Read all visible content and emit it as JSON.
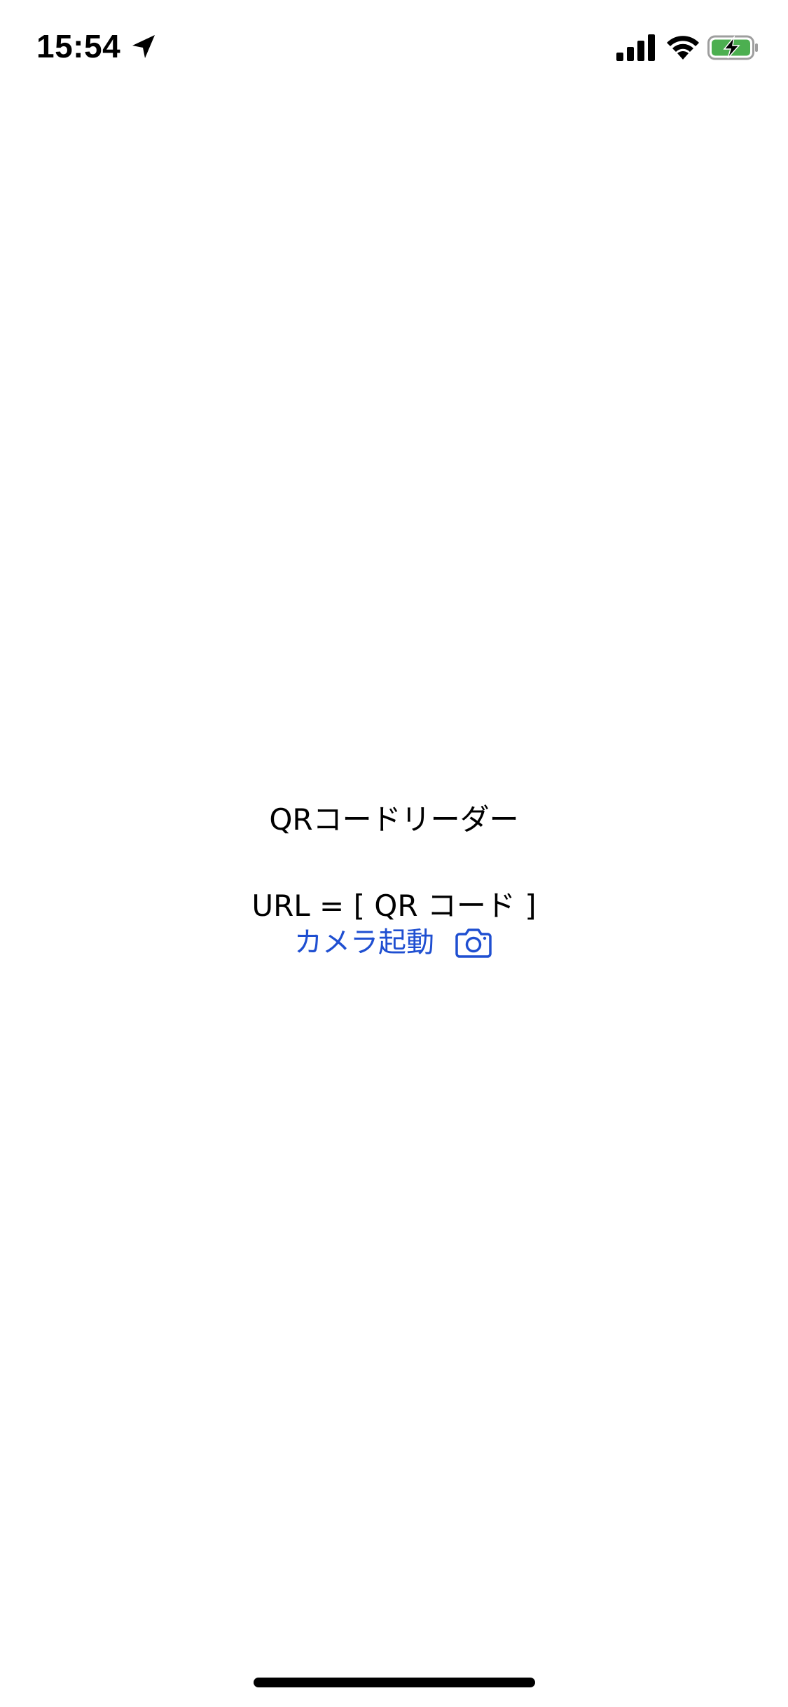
{
  "status_bar": {
    "time": "15:54",
    "location_icon": "location-arrow-icon",
    "signal_icon": "cellular-signal-icon",
    "wifi_icon": "wifi-icon",
    "battery_icon": "battery-charging-icon",
    "battery_color": "#4caf50"
  },
  "main": {
    "title": "QRコードリーダー",
    "url_line": "URL = [ QR コード ]",
    "camera_button": {
      "label": "カメラ起動",
      "icon": "camera-icon",
      "color": "#1f4fd1"
    }
  }
}
